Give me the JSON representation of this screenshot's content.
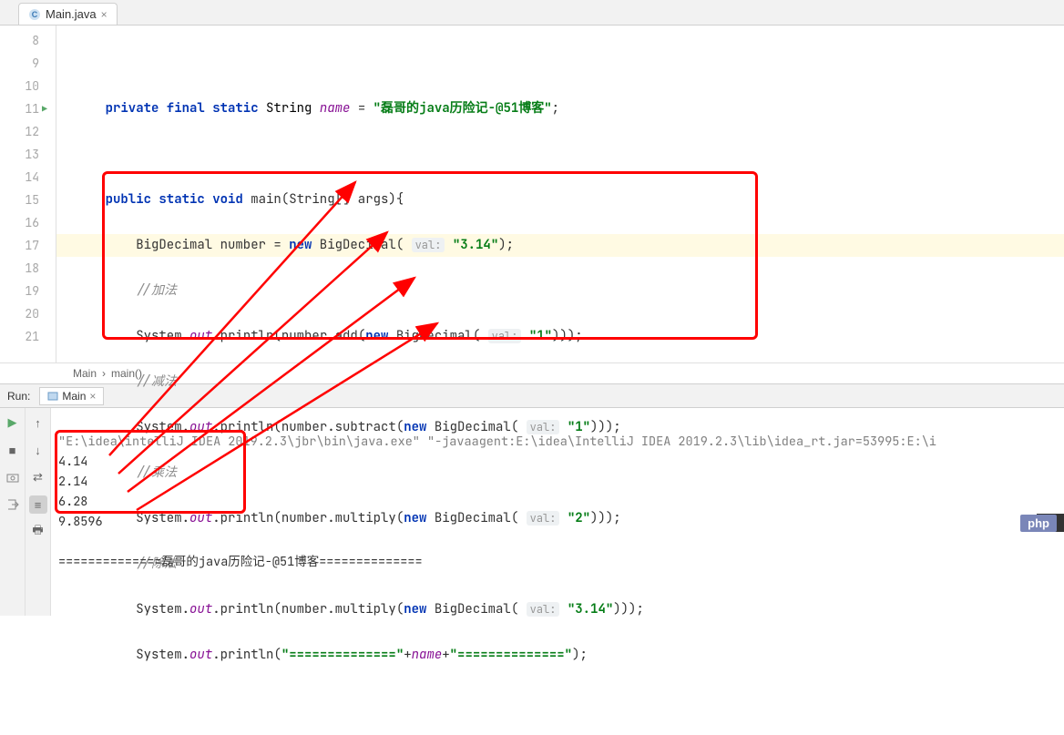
{
  "tab": {
    "filename": "Main.java"
  },
  "gutter": {
    "lines": [
      "8",
      "9",
      "10",
      "11",
      "12",
      "13",
      "14",
      "15",
      "16",
      "17",
      "18",
      "19",
      "20",
      "21"
    ]
  },
  "code": {
    "l9": {
      "kw1": "private final static",
      "type": "String",
      "field": "name",
      "eq": " = ",
      "str": "\"磊哥的java历险记-@51博客\"",
      "end": ";"
    },
    "l11": {
      "kw": "public static void",
      "fn": " main(String[] args){"
    },
    "l12": {
      "pre": "BigDecimal number = ",
      "kw": "new",
      "post": " BigDecimal( ",
      "hint": "val:",
      "str": "\"3.14\"",
      "end": ");"
    },
    "l13": {
      "comment": "//加法"
    },
    "l14": {
      "pre": "System.",
      "out": "out",
      "mid": ".println(number.add(",
      "kw": "new",
      "post": " BigDecimal( ",
      "hint": "val:",
      "str": "\"1\"",
      "end": ")));"
    },
    "l15": {
      "comment": "//减法"
    },
    "l16": {
      "pre": "System.",
      "out": "out",
      "mid": ".println(number.subtract(",
      "kw": "new",
      "post": " BigDecimal( ",
      "hint": "val:",
      "str": "\"1\"",
      "end": ")));"
    },
    "l17": {
      "comment": "//乘法"
    },
    "l18": {
      "pre": "System.",
      "out": "out",
      "mid": ".println(number.multiply(",
      "kw": "new",
      "post": " BigDecimal( ",
      "hint": "val:",
      "str": "\"2\"",
      "end": ")));"
    },
    "l19": {
      "comment": "//除法"
    },
    "l20": {
      "pre": "System.",
      "out": "out",
      "mid": ".println(number.multiply(",
      "kw": "new",
      "post": " BigDecimal( ",
      "hint": "val:",
      "str": "\"3.14\"",
      "end": ")));"
    },
    "l21": {
      "pre": "System.",
      "out": "out",
      "mid": ".println(",
      "str1": "\"==============\"",
      "plus": "+",
      "field": "name",
      "plus2": "+",
      "str2": "\"==============\"",
      "end": ");"
    }
  },
  "breadcrumb": {
    "class": "Main",
    "method": "main()"
  },
  "run": {
    "label": "Run:",
    "tab": "Main",
    "cmd": "\"E:\\idea\\intelliJ IDEA 2019.2.3\\jbr\\bin\\java.exe\" \"-javaagent:E:\\idea\\IntelliJ IDEA 2019.2.3\\lib\\idea_rt.jar=53995:E:\\i",
    "out1": "4.14",
    "out2": "2.14",
    "out3": "6.28",
    "out4": "9.8596",
    "sep": "==============磊哥的java历险记-@51博客=============="
  },
  "badge": {
    "php": "php"
  }
}
